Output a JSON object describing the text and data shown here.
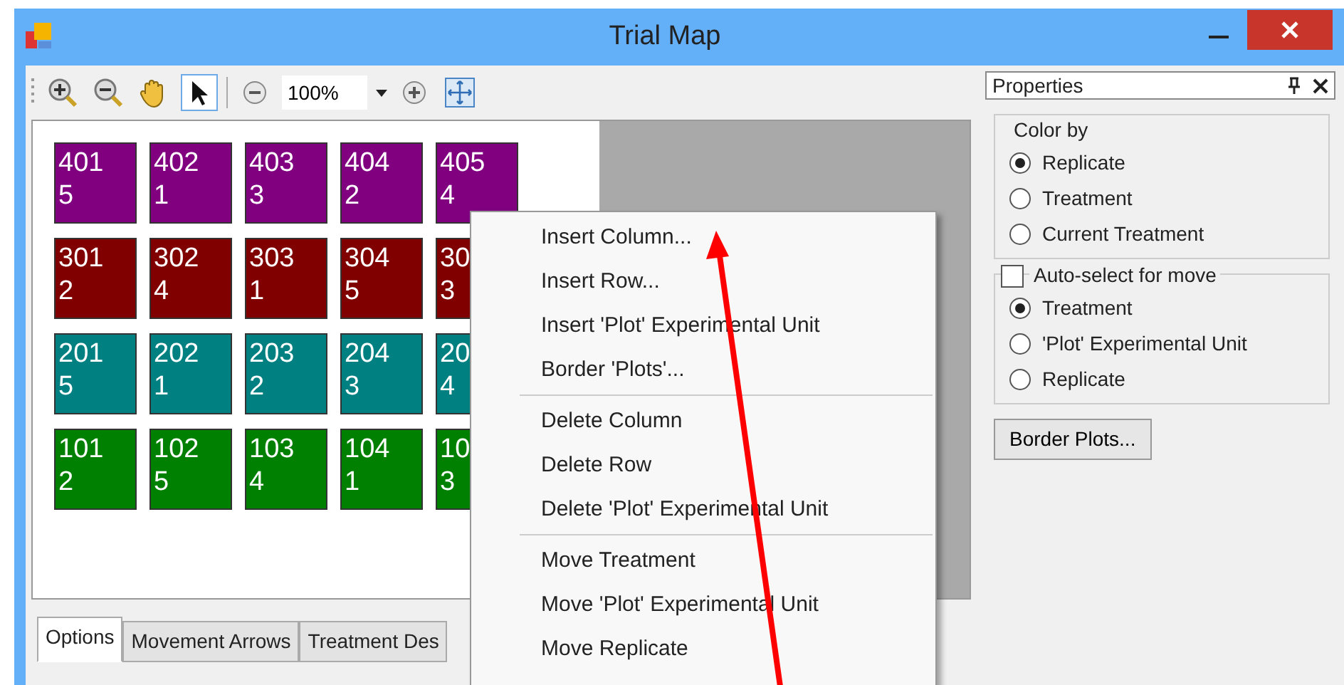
{
  "window": {
    "title": "Trial Map"
  },
  "toolbar": {
    "zoom": "100%"
  },
  "plots": [
    {
      "kind": "replicate4",
      "lines": [
        "401",
        "5"
      ]
    },
    {
      "kind": "replicate4",
      "lines": [
        "402",
        "1"
      ]
    },
    {
      "kind": "replicate4",
      "lines": [
        "403",
        "3"
      ]
    },
    {
      "kind": "replicate4",
      "lines": [
        "404",
        "2"
      ]
    },
    {
      "kind": "replicate4",
      "lines": [
        "405",
        "4"
      ]
    },
    {
      "kind": "replicate3",
      "lines": [
        "301",
        "2"
      ]
    },
    {
      "kind": "replicate3",
      "lines": [
        "302",
        "4"
      ]
    },
    {
      "kind": "replicate3",
      "lines": [
        "303",
        "1"
      ]
    },
    {
      "kind": "replicate3",
      "lines": [
        "304",
        "5"
      ]
    },
    {
      "kind": "replicate3",
      "lines": [
        "30",
        "3"
      ]
    },
    {
      "kind": "replicate2",
      "lines": [
        "201",
        "5"
      ]
    },
    {
      "kind": "replicate2",
      "lines": [
        "202",
        "1"
      ]
    },
    {
      "kind": "replicate2",
      "lines": [
        "203",
        "2"
      ]
    },
    {
      "kind": "replicate2",
      "lines": [
        "204",
        "3"
      ]
    },
    {
      "kind": "replicate2",
      "lines": [
        "20",
        "4"
      ]
    },
    {
      "kind": "replicate1",
      "lines": [
        "101",
        "2"
      ]
    },
    {
      "kind": "replicate1",
      "lines": [
        "102",
        "5"
      ]
    },
    {
      "kind": "replicate1",
      "lines": [
        "103",
        "4"
      ]
    },
    {
      "kind": "replicate1",
      "lines": [
        "104",
        "1"
      ]
    },
    {
      "kind": "replicate1",
      "lines": [
        "10",
        "3"
      ]
    }
  ],
  "tabs": [
    {
      "label": "Options",
      "selected": true
    },
    {
      "label": "Movement Arrows",
      "selected": false
    },
    {
      "label": "Treatment Des",
      "selected": false
    }
  ],
  "properties": {
    "title": "Properties",
    "color_by": {
      "label": "Color by",
      "options": [
        {
          "label": "Replicate",
          "selected": true
        },
        {
          "label": "Treatment",
          "selected": false
        },
        {
          "label": "Current Treatment",
          "selected": false
        }
      ]
    },
    "auto_select": {
      "label": "Auto-select for move",
      "checked": false,
      "options": [
        {
          "label": "Treatment",
          "selected": true
        },
        {
          "label": "'Plot' Experimental Unit",
          "selected": false
        },
        {
          "label": "Replicate",
          "selected": false
        }
      ]
    },
    "button": "Border Plots..."
  },
  "context_menu": [
    [
      {
        "label": "Insert Column..."
      },
      {
        "label": "Insert Row..."
      },
      {
        "label": "Insert 'Plot' Experimental Unit"
      },
      {
        "label": "Border 'Plots'..."
      }
    ],
    [
      {
        "label": "Delete Column"
      },
      {
        "label": "Delete Row"
      },
      {
        "label": "Delete 'Plot' Experimental Unit"
      }
    ],
    [
      {
        "label": "Move Treatment"
      },
      {
        "label": "Move 'Plot' Experimental Unit"
      },
      {
        "label": "Move Replicate"
      }
    ]
  ]
}
